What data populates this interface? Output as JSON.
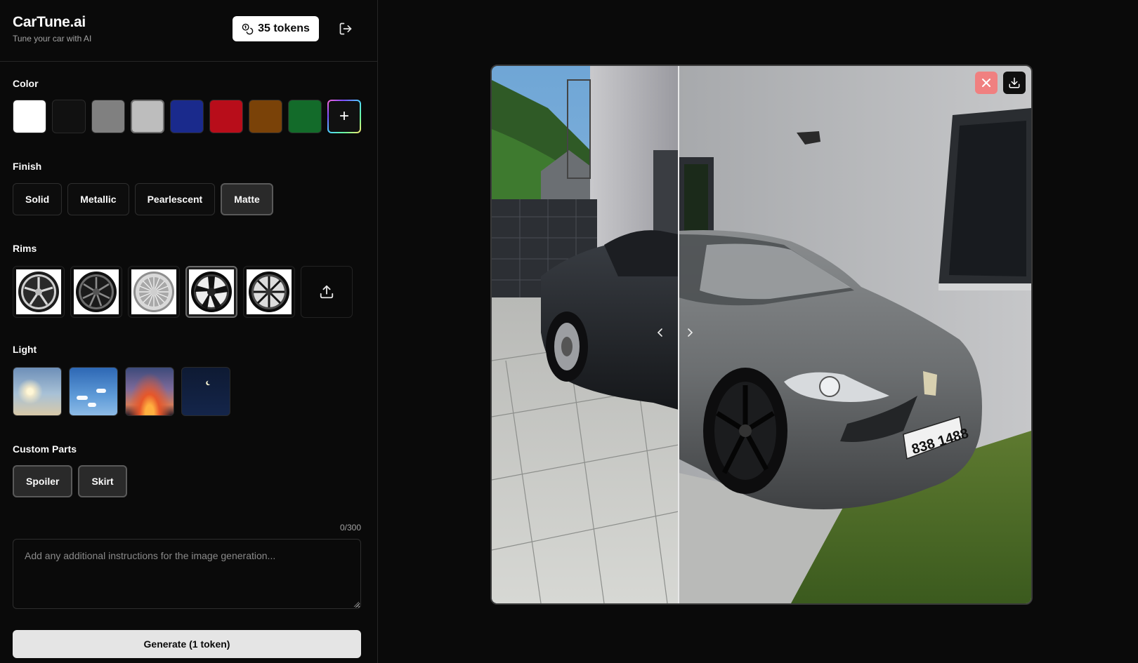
{
  "app": {
    "title": "CarTune.ai",
    "subtitle": "Tune your car with AI"
  },
  "tokens": {
    "label": "35 tokens"
  },
  "icons": {
    "tokens": "coins-icon",
    "logout": "logout-icon",
    "upload": "upload-icon",
    "plus": "plus-icon",
    "close": "close-icon",
    "download": "download-icon"
  },
  "sections": {
    "color": "Color",
    "finish": "Finish",
    "rims": "Rims",
    "light": "Light",
    "custom_parts": "Custom Parts"
  },
  "colors": [
    {
      "hex": "#ffffff",
      "selected": false
    },
    {
      "hex": "#111111",
      "selected": false
    },
    {
      "hex": "#808080",
      "selected": false
    },
    {
      "hex": "#bdbdbd",
      "selected": true
    },
    {
      "hex": "#1a2a8c",
      "selected": false
    },
    {
      "hex": "#b80d1a",
      "selected": false
    },
    {
      "hex": "#7a4208",
      "selected": false
    },
    {
      "hex": "#136b2a",
      "selected": false
    }
  ],
  "color_add_label": "+",
  "finishes": [
    {
      "label": "Solid",
      "selected": false
    },
    {
      "label": "Metallic",
      "selected": false
    },
    {
      "label": "Pearlescent",
      "selected": false
    },
    {
      "label": "Matte",
      "selected": true
    }
  ],
  "rims": [
    {
      "style": "silver-split-spoke",
      "selected": false
    },
    {
      "style": "dark-multi-spoke",
      "selected": false
    },
    {
      "style": "silver-mesh",
      "selected": false
    },
    {
      "style": "black-five-spoke",
      "selected": true
    },
    {
      "style": "black-multi-spoke",
      "selected": false
    }
  ],
  "lights": [
    {
      "style": "sunny",
      "selected": false
    },
    {
      "style": "cloudy",
      "selected": false
    },
    {
      "style": "sunset",
      "selected": false
    },
    {
      "style": "night",
      "selected": false
    }
  ],
  "custom_parts": [
    {
      "label": "Spoiler",
      "selected": true
    },
    {
      "label": "Skirt",
      "selected": true
    }
  ],
  "notes": {
    "counter": "0/300",
    "placeholder": "Add any additional instructions for the image generation...",
    "value": ""
  },
  "generate": {
    "label": "Generate (1 token)"
  },
  "theme": {
    "bg": "#0a0a0a",
    "border": "#262626",
    "accent_text": "#fafafa",
    "muted": "#a3a3a3",
    "close_bg": "#f08080"
  }
}
